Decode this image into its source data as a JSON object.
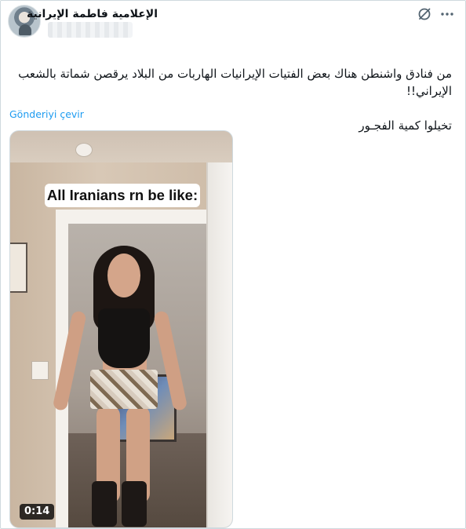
{
  "post": {
    "display_name": "الإعلامية فاطمة الإيرانية",
    "text_line_1": "من فنادق واشنطن هناك بعض الفتيات الإيرانيات الهاربات من البلاد يرقصن شماتة بالشعب الإيراني!!",
    "text_line_2": "تخيلوا كمية الفجـور",
    "translate_label": "Gönderiyi çevir"
  },
  "header_icons": [
    "grok-icon",
    "more-icon"
  ],
  "video": {
    "caption": "All Iranians rn be like:",
    "duration": "0:14"
  },
  "colors": {
    "accent": "#1d9bf0",
    "text": "#0f1419",
    "border": "#cfd9de"
  }
}
